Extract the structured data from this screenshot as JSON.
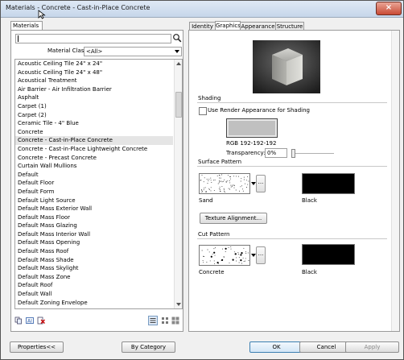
{
  "window": {
    "title": "Materials - Concrete - Cast-in-Place Concrete",
    "close_icon": "×"
  },
  "left": {
    "tab_label": "Materials",
    "search": {
      "value": ""
    },
    "material_class": {
      "label": "Material Class:",
      "value": "<All>"
    },
    "materials": [
      "Acoustic Ceiling Tile 24\" x 24\"",
      "Acoustic Ceiling Tile 24\" x 48\"",
      "Acoustical Treatment",
      "Air Barrier - Air Infiltration Barrier",
      "Asphalt",
      "Carpet (1)",
      "Carpet (2)",
      "Ceramic Tile - 4\" Blue",
      "Concrete",
      "Concrete - Cast-in-Place Concrete",
      "Concrete - Cast-in-Place Lightweight Concrete",
      "Concrete - Precast Concrete",
      "Curtain Wall Mullions",
      "Default",
      "Default Floor",
      "Default Form",
      "Default Light Source",
      "Default Mass Exterior Wall",
      "Default Mass Floor",
      "Default Mass Glazing",
      "Default Mass Interior Wall",
      "Default Mass Opening",
      "Default Mass Roof",
      "Default Mass Shade",
      "Default Mass Skylight",
      "Default Mass Zone",
      "Default Roof",
      "Default Wall",
      "Default Zoning Envelope"
    ],
    "selected_index": 9
  },
  "tabs": [
    {
      "label": "Identity",
      "active": false
    },
    {
      "label": "Graphics",
      "active": true
    },
    {
      "label": "Appearance",
      "active": false
    },
    {
      "label": "Structure",
      "active": false
    }
  ],
  "graphics": {
    "shading": {
      "title": "Shading",
      "use_render_label": "Use Render Appearance for Shading",
      "use_render_checked": false,
      "color_label": "RGB 192-192-192",
      "color_hex": "#c0c0c0",
      "transparency_label": "Transparency:",
      "transparency_value": "0%",
      "transparency_level": 0
    },
    "surface_pattern": {
      "title": "Surface Pattern",
      "pattern_name": "Sand",
      "color_name": "Black",
      "color_hex": "#000000",
      "more_label": "...",
      "align_button": "Texture Alignment..."
    },
    "cut_pattern": {
      "title": "Cut Pattern",
      "pattern_name": "Concrete",
      "color_name": "Black",
      "color_hex": "#000000",
      "more_label": "..."
    }
  },
  "footer": {
    "properties": "Properties<<",
    "by_category": "By Category",
    "ok": "OK",
    "cancel": "Cancel",
    "apply": "Apply"
  }
}
